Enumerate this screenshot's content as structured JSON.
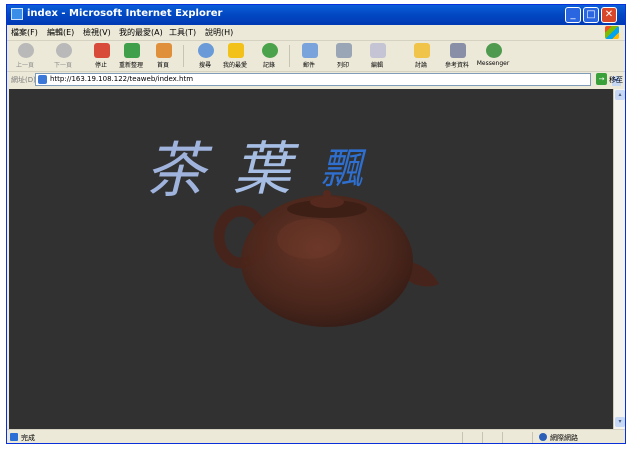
{
  "window": {
    "title": "index - Microsoft Internet Explorer",
    "controls": {
      "minimize": "_",
      "maximize": "□",
      "close": "✕"
    }
  },
  "menu": [
    "檔案(F)",
    "編輯(E)",
    "檢視(V)",
    "我的最愛(A)",
    "工具(T)",
    "說明(H)"
  ],
  "toolbar": {
    "back": "上一頁",
    "forward": "下一頁",
    "stop": "停止",
    "refresh": "重新整理",
    "home": "首頁",
    "search": "搜尋",
    "favorites": "我的最愛",
    "history": "記錄",
    "mail": "郵件",
    "print": "列印",
    "edit": "編輯",
    "discuss": "討論",
    "research": "參考資料",
    "messenger": "Messenger"
  },
  "address": {
    "label": "網址(D)",
    "url": "http://163.19.108.122/teaweb/index.htm",
    "dropdown": "▾",
    "go_arrow": "→",
    "go_label": "移至"
  },
  "content": {
    "calligraphy": [
      "茶",
      "葉",
      "飄"
    ]
  },
  "scrollbar": {
    "up": "▴",
    "down": "▾"
  },
  "status": {
    "text": "完成",
    "zone": "網際網路"
  },
  "colors": {
    "title_bar": "#0349c4",
    "page_background": "#313131",
    "calligraphy_light": "#a6bde4",
    "calligraphy_accent": "#2e6fd0",
    "teapot": "#5a2a1f"
  },
  "icons": [
    "back-icon",
    "forward-icon",
    "stop-icon",
    "refresh-icon",
    "home-icon",
    "search-icon",
    "favorites-star-icon",
    "history-icon",
    "mail-icon",
    "print-icon",
    "edit-icon",
    "discuss-icon",
    "research-icon",
    "messenger-icon",
    "teapot-image"
  ]
}
